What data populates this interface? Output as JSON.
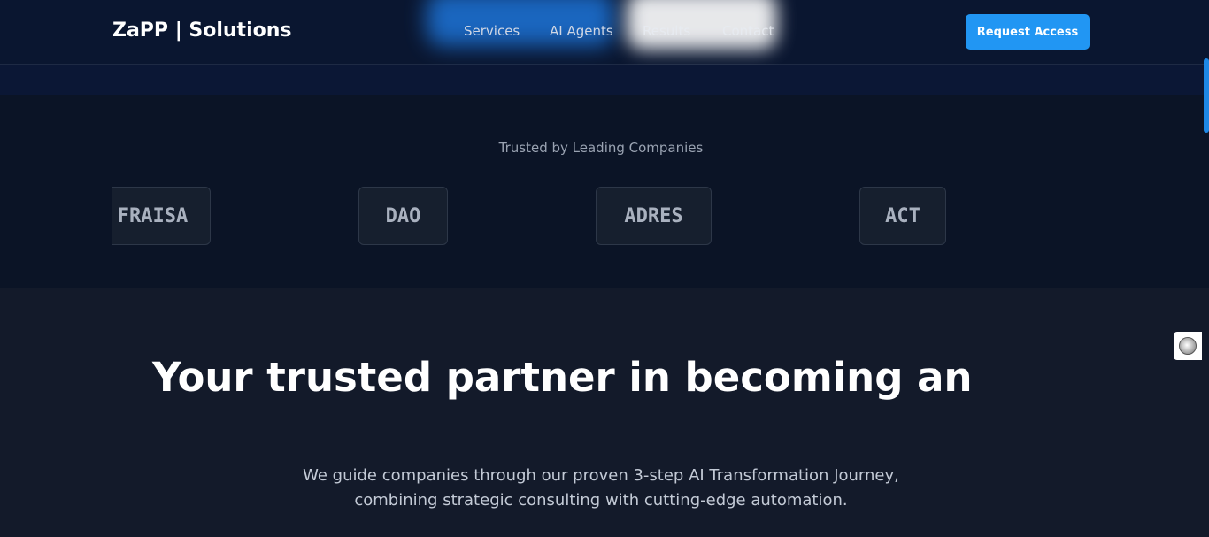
{
  "header": {
    "logo": "ZaPP | Solutions",
    "nav": [
      "Services",
      "AI Agents",
      "Results",
      "Contact"
    ],
    "cta_label": "Request Access"
  },
  "trusted": {
    "title": "Trusted by Leading Companies",
    "logos": [
      "FRAISA",
      "DAO",
      "ADRES",
      "ACT"
    ]
  },
  "hero": {
    "headline": "Your trusted partner in becoming an",
    "subtext_line1": "We guide companies through our proven 3-step AI Transformation Journey,",
    "subtext_line2": "combining strategic consulting with cutting-edge automation."
  },
  "colors": {
    "accent": "#2196f3",
    "background": "#111827"
  },
  "widgets": {
    "floating_icon": "chat-bubble-icon"
  }
}
